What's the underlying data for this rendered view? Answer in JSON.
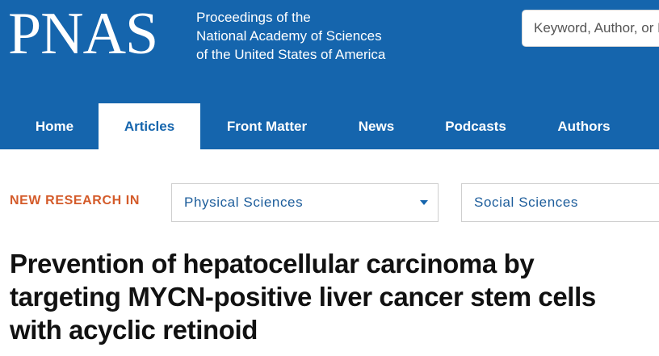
{
  "header": {
    "logo": "PNAS",
    "tagline": [
      "Proceedings of the",
      "National Academy of Sciences",
      "of the United States of America"
    ],
    "search_placeholder": "Keyword, Author, or DOI"
  },
  "nav": {
    "items": [
      {
        "label": "Home"
      },
      {
        "label": "Articles",
        "active": true
      },
      {
        "label": "Front Matter"
      },
      {
        "label": "News"
      },
      {
        "label": "Podcasts"
      },
      {
        "label": "Authors"
      }
    ]
  },
  "filter": {
    "new_research_label": "NEW RESEARCH IN",
    "physical_sciences": "Physical Sciences",
    "social_sciences": "Social Sciences"
  },
  "article": {
    "title": "Prevention of hepatocellular carcinoma by targeting MYCN-positive liver cancer stem cells with acyclic retinoid"
  },
  "colors": {
    "brand_blue": "#1565ad",
    "accent_orange": "#d45b2a"
  }
}
